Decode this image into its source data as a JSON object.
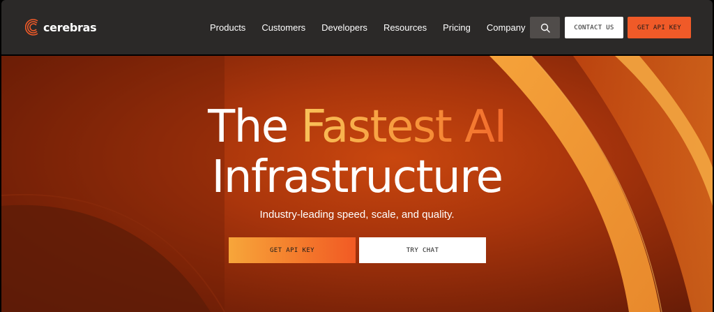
{
  "brand": {
    "name": "cerebras",
    "accent_color": "#f05a28"
  },
  "nav": {
    "items": [
      {
        "label": "Products"
      },
      {
        "label": "Customers"
      },
      {
        "label": "Developers"
      },
      {
        "label": "Resources"
      },
      {
        "label": "Pricing"
      },
      {
        "label": "Company"
      }
    ],
    "search_icon": "search-icon",
    "contact_label": "CONTACT US",
    "api_key_label": "GET API KEY"
  },
  "hero": {
    "headline_plain": "The ",
    "headline_accent": "Fastest AI",
    "headline_line2": "Infrastructure",
    "subtitle": "Industry-leading speed, scale, and quality.",
    "primary_cta": "GET API KEY",
    "secondary_cta": "TRY CHAT"
  }
}
